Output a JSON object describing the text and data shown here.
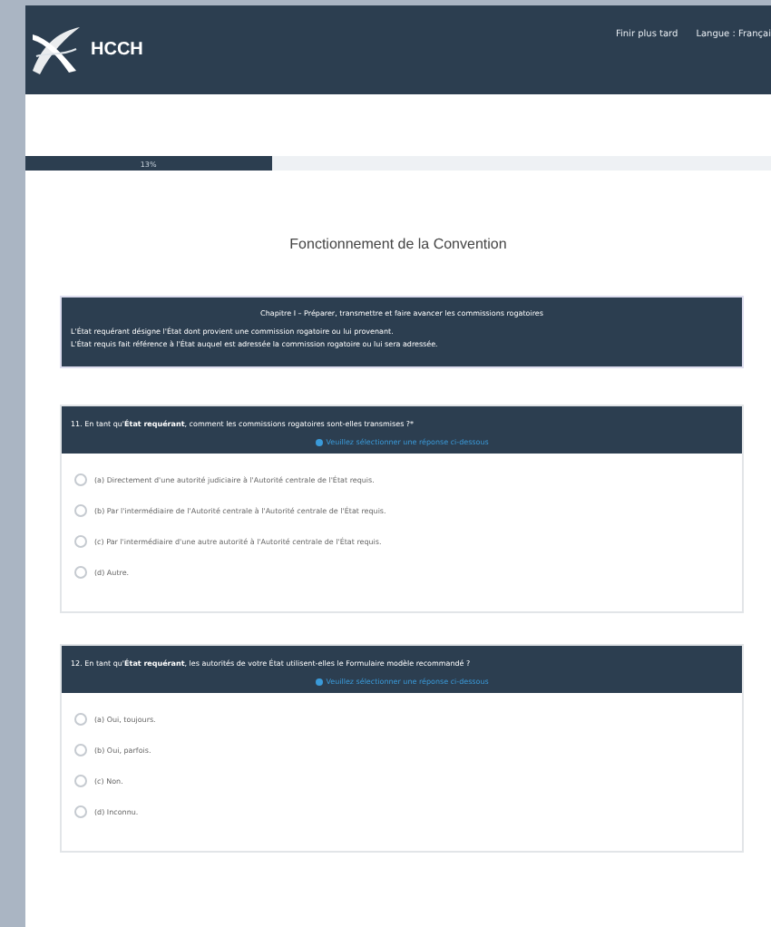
{
  "header": {
    "logo_text": "HCCH",
    "links": [
      {
        "label": "Finir plus tard"
      },
      {
        "label": "Langue : Françai"
      }
    ]
  },
  "progress": {
    "label": "13%",
    "level": 0.33
  },
  "title": "Fonctionnement de la Convention",
  "chapter": {
    "heading": "Chapitre I – Préparer, transmettre et faire avancer les commissions rogatoires",
    "lines": [
      "L'État requérant désigne l'État dont provient une commission rogatoire ou lui provenant.",
      "L'État requis fait référence à l'État auquel est adressée la commission rogatoire ou lui sera adressée."
    ]
  },
  "questions": [
    {
      "text": "11. En tant qu'**État requérant**, comment les commissions rogatoires sont-elles transmises ?*",
      "hint": "Veuillez sélectionner une réponse ci-dessous",
      "options": [
        {
          "label": "(a) Directement d'une autorité judiciaire à l'Autorité centrale de l'État requis.",
          "selected": false
        },
        {
          "label": "(b) Par l'intermédiaire de l'Autorité centrale à l'Autorité centrale de l'État requis.",
          "selected": false
        },
        {
          "label": "(c) Par l'intermédiaire d'une autre autorité à l'Autorité centrale de l'État requis.",
          "selected": false
        },
        {
          "label": "(d) Autre.",
          "selected": false
        }
      ]
    },
    {
      "text": "12. En tant qu'**État requérant**, les autorités de votre État utilisent-elles le Formulaire modèle recommandé ?",
      "hint": "Veuillez sélectionner une réponse ci-dessous",
      "options": [
        {
          "label": "(a) Oui, toujours.",
          "selected": false
        },
        {
          "label": "(b) Oui, parfois.",
          "selected": false
        },
        {
          "label": "(c) Non.",
          "selected": false
        },
        {
          "label": "(d) Inconnu.",
          "selected": false
        }
      ]
    }
  ]
}
